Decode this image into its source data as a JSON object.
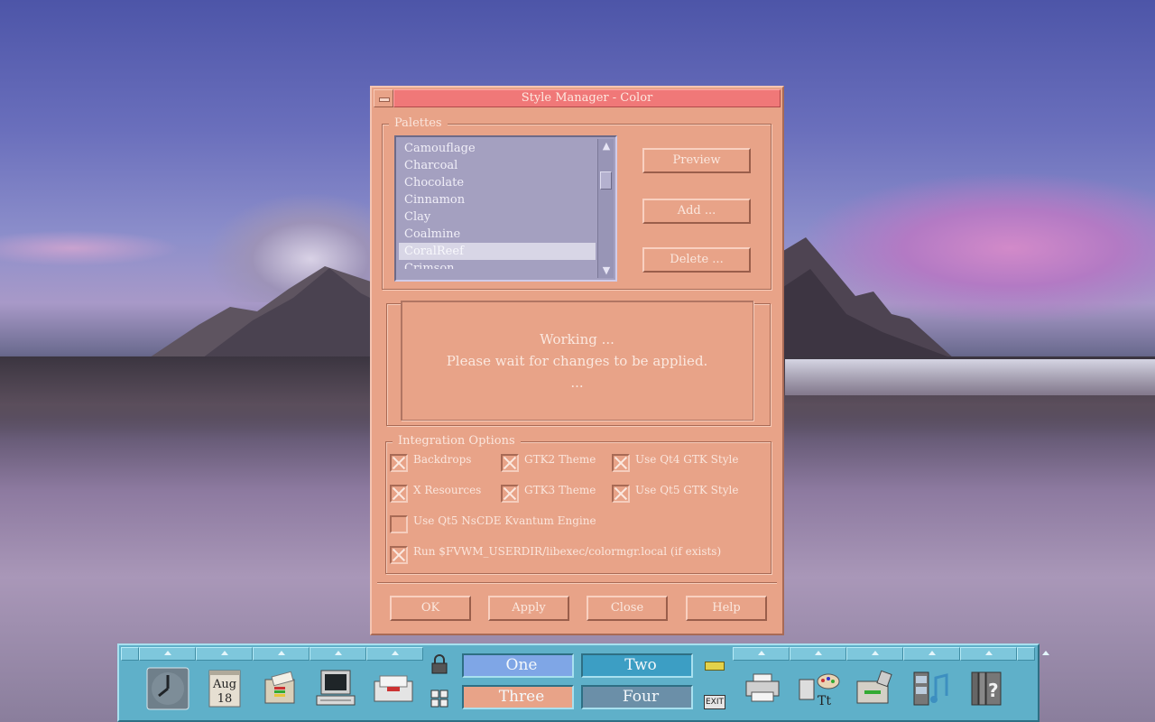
{
  "dialog": {
    "title": "Style Manager - Color",
    "palettes": {
      "label": "Palettes",
      "items": [
        "Camouflage",
        "Charcoal",
        "Chocolate",
        "Cinnamon",
        "Clay",
        "Coalmine",
        "CoralReef",
        "Crimson"
      ],
      "selected": "CoralReef"
    },
    "buttons": {
      "preview": "Preview",
      "add": "Add ...",
      "delete": "Delete ..."
    },
    "working": {
      "line1": "Working ...",
      "line2": "Please wait for changes to be applied.",
      "line3": "..."
    },
    "integration": {
      "label": "Integration Options",
      "options": [
        {
          "label": "Backdrops",
          "checked": true
        },
        {
          "label": "GTK2 Theme",
          "checked": true
        },
        {
          "label": "Use Qt4 GTK Style",
          "checked": true
        },
        {
          "label": "X Resources",
          "checked": true
        },
        {
          "label": "GTK3 Theme",
          "checked": true
        },
        {
          "label": "Use Qt5 GTK Style",
          "checked": true
        },
        {
          "label": "Use Qt5 NsCDE Kvantum Engine",
          "checked": false
        },
        {
          "label": "Run $FVWM_USERDIR/libexec/colormgr.local (if exists)",
          "checked": true
        }
      ]
    },
    "actions": {
      "ok": "OK",
      "apply": "Apply",
      "close": "Close",
      "help": "Help"
    }
  },
  "panel": {
    "calendar": {
      "month": "Aug",
      "day": "18"
    },
    "workspaces": [
      "One",
      "Two",
      "Three",
      "Four"
    ],
    "exit_label": "EXIT",
    "colors": {
      "panel": "#5fb0c9",
      "ws_one": "#7fa6e6",
      "ws_two": "#3c9ec4",
      "ws_three": "#e8a388",
      "ws_four": "#6b8fa8"
    }
  },
  "colors": {
    "dialog_bg": "#e8a388",
    "title_bg": "#f07878",
    "list_bg": "#a4a0c0"
  }
}
